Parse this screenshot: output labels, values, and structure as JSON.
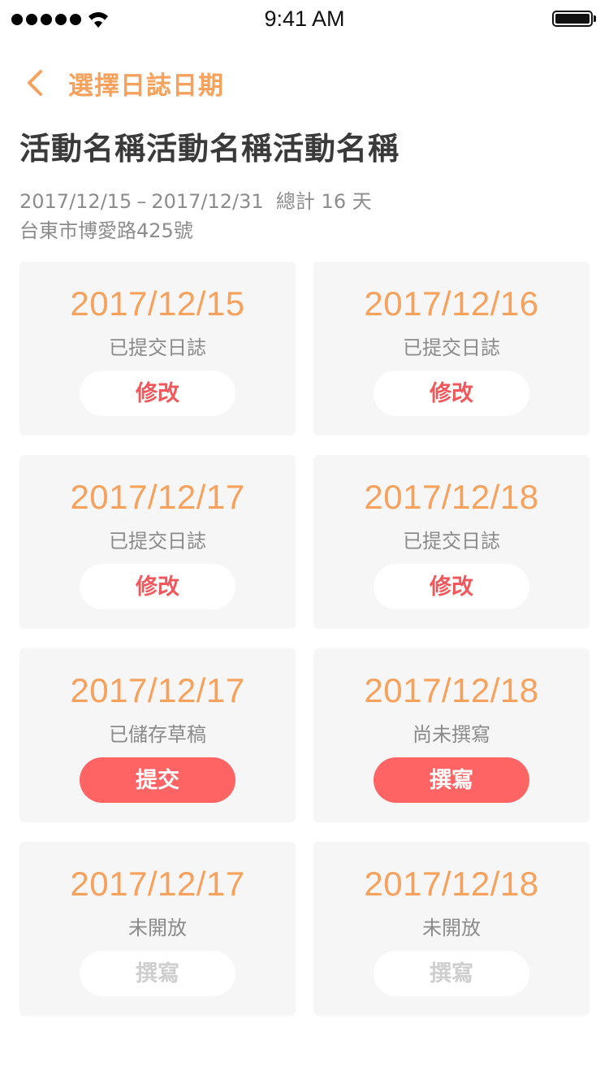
{
  "status_bar": {
    "time": "9:41 AM"
  },
  "header": {
    "back_icon": "chevron-left-icon",
    "title": "選擇日誌日期"
  },
  "event": {
    "name": "活動名稱活動名稱活動名稱",
    "start_date": "2017/12/15",
    "range_separator": "–",
    "end_date": "2017/12/31",
    "total_label": "總計 16 天",
    "address": "台東市博愛路425號"
  },
  "colors": {
    "accent_orange": "#f6a15c",
    "action_red": "#ff6465",
    "card_bg": "#f6f6f6",
    "disabled_text": "#cfcfcf"
  },
  "cards": [
    {
      "date": "2017/12/15",
      "status": "已提交日誌",
      "action": "修改",
      "action_style": "secondary"
    },
    {
      "date": "2017/12/16",
      "status": "已提交日誌",
      "action": "修改",
      "action_style": "secondary"
    },
    {
      "date": "2017/12/17",
      "status": "已提交日誌",
      "action": "修改",
      "action_style": "secondary"
    },
    {
      "date": "2017/12/18",
      "status": "已提交日誌",
      "action": "修改",
      "action_style": "secondary"
    },
    {
      "date": "2017/12/17",
      "status": "已儲存草稿",
      "action": "提交",
      "action_style": "primary"
    },
    {
      "date": "2017/12/18",
      "status": "尚未撰寫",
      "action": "撰寫",
      "action_style": "primary"
    },
    {
      "date": "2017/12/17",
      "status": "未開放",
      "action": "撰寫",
      "action_style": "disabled"
    },
    {
      "date": "2017/12/18",
      "status": "未開放",
      "action": "撰寫",
      "action_style": "disabled"
    }
  ]
}
